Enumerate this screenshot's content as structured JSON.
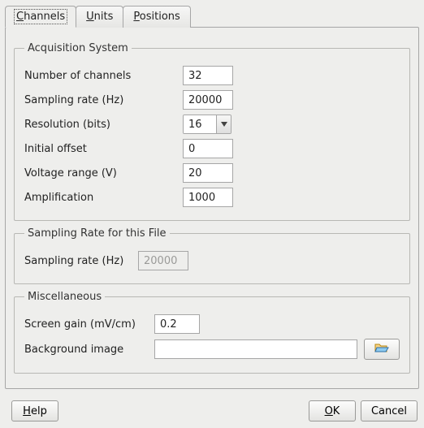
{
  "tabs": [
    {
      "label_pre": "",
      "label_u": "C",
      "label_post": "hannels",
      "active": true
    },
    {
      "label_pre": "",
      "label_u": "U",
      "label_post": "nits",
      "active": false
    },
    {
      "label_pre": "",
      "label_u": "P",
      "label_post": "ositions",
      "active": false
    }
  ],
  "groups": {
    "acq": {
      "legend": "Acquisition System",
      "rows": {
        "nchan": {
          "label": "Number of channels",
          "value": "32"
        },
        "srate": {
          "label": "Sampling rate (Hz)",
          "value": "20000"
        },
        "res": {
          "label": "Resolution (bits)",
          "value": "16"
        },
        "offset": {
          "label": "Initial offset",
          "value": "0"
        },
        "vrange": {
          "label": "Voltage range (V)",
          "value": "20"
        },
        "amp": {
          "label": "Amplification",
          "value": "1000"
        }
      }
    },
    "file_sr": {
      "legend": "Sampling Rate for this File",
      "rows": {
        "srate": {
          "label": "Sampling rate (Hz)",
          "value": "20000"
        }
      }
    },
    "misc": {
      "legend": "Miscellaneous",
      "rows": {
        "gain": {
          "label": "Screen gain (mV/cm)",
          "value": "0.2"
        },
        "bg": {
          "label": "Background image",
          "value": ""
        }
      }
    }
  },
  "buttons": {
    "help": {
      "u": "H",
      "rest": "elp"
    },
    "ok": {
      "u": "O",
      "rest": "K"
    },
    "cancel": {
      "label": "Cancel"
    }
  }
}
